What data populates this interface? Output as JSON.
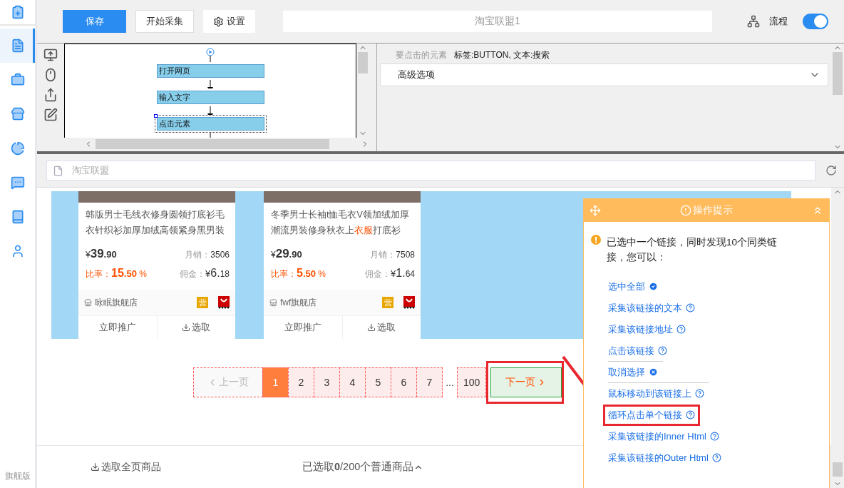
{
  "sidebar": {
    "items": [
      {
        "kind": "clipboard",
        "selected": false
      },
      {
        "kind": "document",
        "selected": true
      },
      {
        "kind": "briefcase",
        "selected": false
      },
      {
        "kind": "store",
        "selected": false
      },
      {
        "kind": "chart",
        "selected": false
      },
      {
        "kind": "chat",
        "selected": false
      },
      {
        "kind": "book",
        "selected": false
      },
      {
        "kind": "user",
        "selected": false
      }
    ],
    "edition": "旗舰版"
  },
  "toolbar": {
    "save": "保存",
    "start": "开始采集",
    "settings": "设置",
    "task_name": "淘宝联盟1",
    "flow_label": "流程",
    "flow_on": true
  },
  "flowchart": {
    "nodes": [
      {
        "label": "打开网页",
        "selected": false
      },
      {
        "label": "输入文字",
        "selected": false
      },
      {
        "label": "点击元素",
        "selected": true
      }
    ]
  },
  "properties": {
    "element_label": "要点击的元素",
    "element_value": "标签:BUTTON, 文本:搜索",
    "advanced": "高级选项",
    "advanced_expanded": false
  },
  "address_bar": {
    "value": "淘宝联盟"
  },
  "products": [
    {
      "title": [
        {
          "text": "韩版男士毛线衣修身圆领打底衫毛衣针织衫加厚加绒高领紧身黑男装",
          "highlight": false
        }
      ],
      "currency": "¥",
      "price_int": "39",
      "price_dec": ".90",
      "sales_label": "月销：",
      "sales": "3506",
      "rate_label": "比率：",
      "rate_int": "15",
      "rate_dec": ".50",
      "rate_unit": "%",
      "commission_label": "佣金：",
      "commission_currency": "¥",
      "commission_int": "6.",
      "commission_dec": "18",
      "shop": "咏眠旗舰店",
      "badge": "营",
      "promote": "立即推广",
      "pick": "选取"
    },
    {
      "title": [
        {
          "text": "冬季男士长袖t恤毛衣V领加绒加厚潮流男装修身秋衣上",
          "highlight": false
        },
        {
          "text": "衣服",
          "highlight": true
        },
        {
          "text": "打底衫",
          "highlight": false
        }
      ],
      "currency": "¥",
      "price_int": "29",
      "price_dec": ".90",
      "sales_label": "月销：",
      "sales": "7508",
      "rate_label": "比率：",
      "rate_int": "5",
      "rate_dec": ".50",
      "rate_unit": "%",
      "commission_label": "佣金：",
      "commission_currency": "¥",
      "commission_int": "1.",
      "commission_dec": "64",
      "shop": "fwf旗舰店",
      "badge": "营",
      "promote": "立即推广",
      "pick": "选取"
    }
  ],
  "pagination": [
    {
      "kind": "prev",
      "label": "上一页",
      "selected": false,
      "highlighted": false
    },
    {
      "kind": "page",
      "label": "1",
      "selected": true,
      "highlighted": false
    },
    {
      "kind": "page",
      "label": "2",
      "selected": false,
      "highlighted": false
    },
    {
      "kind": "page",
      "label": "3",
      "selected": false,
      "highlighted": false
    },
    {
      "kind": "page",
      "label": "4",
      "selected": false,
      "highlighted": false
    },
    {
      "kind": "page",
      "label": "5",
      "selected": false,
      "highlighted": false
    },
    {
      "kind": "page",
      "label": "6",
      "selected": false,
      "highlighted": false
    },
    {
      "kind": "page",
      "label": "7",
      "selected": false,
      "highlighted": false
    },
    {
      "kind": "ellipsis",
      "label": "...",
      "selected": false,
      "highlighted": false
    },
    {
      "kind": "page",
      "label": "100",
      "selected": false,
      "highlighted": false
    },
    {
      "kind": "next",
      "label": "下一页",
      "selected": false,
      "highlighted": true
    }
  ],
  "selection_bar": {
    "select_all": "选取全页商品",
    "summary": "已选取**0**/200个普通商品"
  },
  "tip": {
    "title": "操作提示",
    "message": "已选中一个链接，同时发现10个同类链接，您可以：",
    "actions": [
      {
        "label": "选中全部",
        "kind": "check",
        "divider": false,
        "highlighted": false
      },
      {
        "label": "采集该链接的文本",
        "kind": "help",
        "divider": false,
        "highlighted": false
      },
      {
        "label": "采集该链接地址",
        "kind": "help",
        "divider": false,
        "highlighted": false
      },
      {
        "label": "点击该链接",
        "kind": "help",
        "divider": false,
        "highlighted": false
      },
      {
        "label": "取消选择",
        "kind": "cancel",
        "divider": true,
        "highlighted": false
      },
      {
        "label": "鼠标移动到该链接上",
        "kind": "help",
        "divider": true,
        "highlighted": false
      },
      {
        "label": "循环点击单个链接",
        "kind": "help",
        "divider": false,
        "highlighted": true
      },
      {
        "label": "采集该链接的Inner Html",
        "kind": "help",
        "divider": false,
        "highlighted": false
      },
      {
        "label": "采集该链接的Outer Html",
        "kind": "help",
        "divider": false,
        "highlighted": false
      }
    ]
  }
}
